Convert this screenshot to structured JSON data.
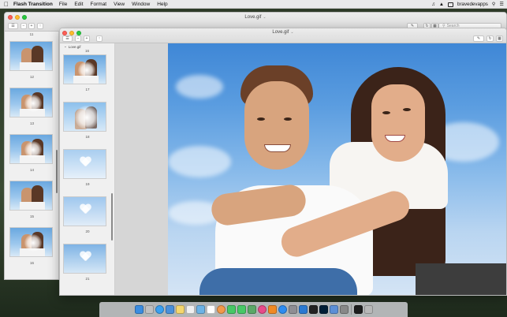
{
  "menubar": {
    "app_name": "Flash Transition",
    "items": [
      "File",
      "Edit",
      "Format",
      "View",
      "Window",
      "Help"
    ],
    "user": "bravedevapps"
  },
  "back_window": {
    "title": "Love.gif",
    "search_placeholder": "Search",
    "header_frame": "11",
    "frames": [
      "12",
      "13",
      "14",
      "15",
      "16"
    ]
  },
  "front_window": {
    "title": "Love.gif",
    "sidebar_title": "Love.gif",
    "header_frame": "16",
    "frames": [
      "17",
      "18",
      "19",
      "20",
      "21"
    ]
  },
  "dock": {
    "icons": [
      "finder-icon",
      "launchpad-icon",
      "safari-icon",
      "mail-icon",
      "notes-icon",
      "reminders-icon",
      "preview-icon",
      "calendar-icon",
      "photos-icon",
      "messages-icon",
      "facetime-icon",
      "maps-icon",
      "itunes-icon",
      "ibooks-icon",
      "appstore-icon",
      "preferences-icon",
      "xcode-icon",
      "terminal-icon",
      "photoshop-icon",
      "finder2-icon",
      "help-icon",
      "flash-transition-icon",
      "trash-icon"
    ],
    "colors": [
      "#3b8de0",
      "#c0c0c0",
      "#3aa0f0",
      "#4a90d9",
      "#f5d76e",
      "#f0f0f0",
      "#6cb3e6",
      "#ffffff",
      "#f2994a",
      "#47c866",
      "#47c866",
      "#5aa867",
      "#e84b8a",
      "#f08a24",
      "#2d8cf0",
      "#8e8e93",
      "#2a79d1",
      "#222222",
      "#001e36",
      "#5c8fd6",
      "#888888",
      "#1d1d1d",
      "#b8b8b8"
    ]
  }
}
